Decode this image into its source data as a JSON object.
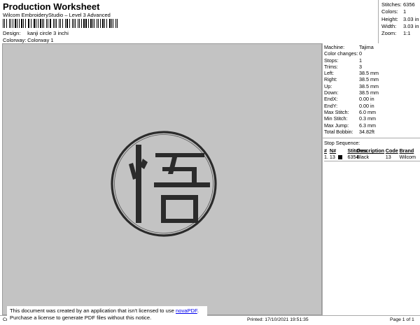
{
  "header": {
    "title": "Production Worksheet",
    "subtitle": "Wilcom EmbroideryStudio – Level 3 Advanced",
    "design_label": "Design:",
    "design_value": "kanji circle 3 inchi",
    "colorway_label": "Colorway:",
    "colorway_value": "Colorway 1"
  },
  "stats": [
    {
      "label": "Stitches:",
      "value": "6356"
    },
    {
      "label": "Colors:",
      "value": "1"
    },
    {
      "label": "Height:",
      "value": "3.03 in"
    },
    {
      "label": "Width:",
      "value": "3.03 in"
    },
    {
      "label": "Zoom:",
      "value": "1:1"
    }
  ],
  "machine_info": [
    {
      "label": "Machine:",
      "value": "Tajima"
    },
    {
      "label": "Color changes:",
      "value": "0"
    },
    {
      "label": "Stops:",
      "value": "1"
    },
    {
      "label": "Trims:",
      "value": "3"
    },
    {
      "label": "Left:",
      "value": "38.5 mm"
    },
    {
      "label": "Right:",
      "value": "38.5 mm"
    },
    {
      "label": "Up:",
      "value": "38.5 mm"
    },
    {
      "label": "Down:",
      "value": "38.5 mm"
    },
    {
      "label": "EndX:",
      "value": "0.00 in"
    },
    {
      "label": "EndY:",
      "value": "0.00 in"
    },
    {
      "label": "Max Stitch:",
      "value": "6.0 mm"
    },
    {
      "label": "Min Stitch:",
      "value": "0.3 mm"
    },
    {
      "label": "Max Jump:",
      "value": "6.3 mm"
    },
    {
      "label": "Total Bobbin:",
      "value": "34.82ft"
    }
  ],
  "stop_sequence": {
    "title": "Stop Sequence:",
    "columns": [
      "#",
      "N#",
      "",
      "Stitches",
      "Description",
      "Code",
      "Brand"
    ],
    "rows": [
      {
        "num": "1.",
        "n": "13",
        "stitches": "6354",
        "description": "Black",
        "code": "13",
        "brand": "Wilcom",
        "color": "#000000"
      }
    ]
  },
  "footer": {
    "left": "Cr",
    "printed": "Printed: 17/10/2021 19:51:35",
    "page": "Page 1 of 1"
  },
  "notice": {
    "line1_before": "This document was created by an application that isn't licensed to use ",
    "link": "novaPDF",
    "line1_after": ".",
    "line2": "Purchase a license to generate PDF files without this notice."
  },
  "colors": {
    "thread": "#2b2b2b",
    "canvas": "#c3c3c3"
  }
}
